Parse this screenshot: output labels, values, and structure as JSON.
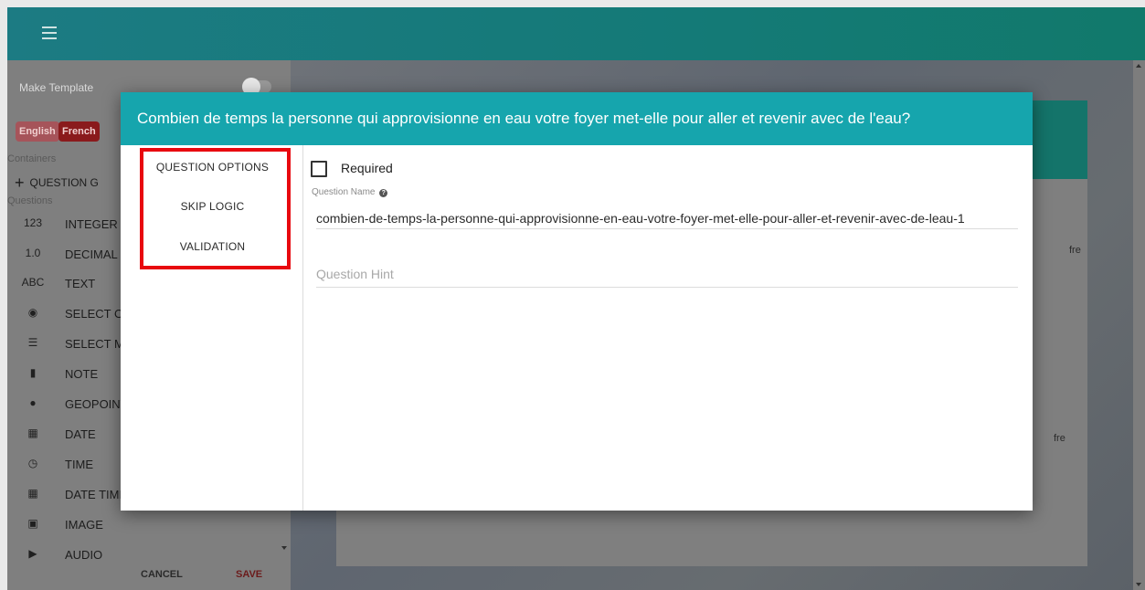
{
  "app": {
    "make_template_label": "Make Template",
    "languages": [
      "English",
      "French"
    ]
  },
  "sidebar": {
    "containers_caption": "Containers",
    "add_group_label": "QUESTION G",
    "questions_caption": "Questions",
    "items": [
      {
        "icon": "123",
        "label": "INTEGER"
      },
      {
        "icon": "1.0",
        "label": "DECIMAL"
      },
      {
        "icon": "ABC",
        "label": "TEXT"
      },
      {
        "icon": "radio-icon",
        "label": "SELECT OI"
      },
      {
        "icon": "list-icon",
        "label": "SELECT M"
      },
      {
        "icon": "note-icon",
        "label": "NOTE"
      },
      {
        "icon": "globe-icon",
        "label": "GEOPOINT"
      },
      {
        "icon": "calendar-icon",
        "label": "DATE"
      },
      {
        "icon": "clock-icon",
        "label": "TIME"
      },
      {
        "icon": "calendar-icon",
        "label": "DATE TIMI"
      },
      {
        "icon": "image-icon",
        "label": "IMAGE"
      },
      {
        "icon": "speaker-icon",
        "label": "AUDIO"
      }
    ],
    "cancel_label": "CANCEL",
    "save_label": "SAVE"
  },
  "background": {
    "fre_1": "fre",
    "fre_2": "fre"
  },
  "modal": {
    "title": "Combien de temps la personne qui approvisionne en eau votre foyer met-elle pour aller et revenir avec de l'eau?",
    "nav": {
      "question_options": "QUESTION OPTIONS",
      "skip_logic": "SKIP LOGIC",
      "validation": "VALIDATION"
    },
    "required_label": "Required",
    "required_checked": false,
    "question_name_label": "Question Name",
    "question_name_value": "combien-de-temps-la-personne-qui-approvisionne-en-eau-votre-foyer-met-elle-pour-aller-et-revenir-avec-de-leau-1",
    "question_hint_placeholder": "Question Hint"
  },
  "colors": {
    "modal_header": "#16a5ad",
    "topbar": "#147a77",
    "highlight_box": "#e8080f",
    "save_text": "#6b1b1b"
  }
}
